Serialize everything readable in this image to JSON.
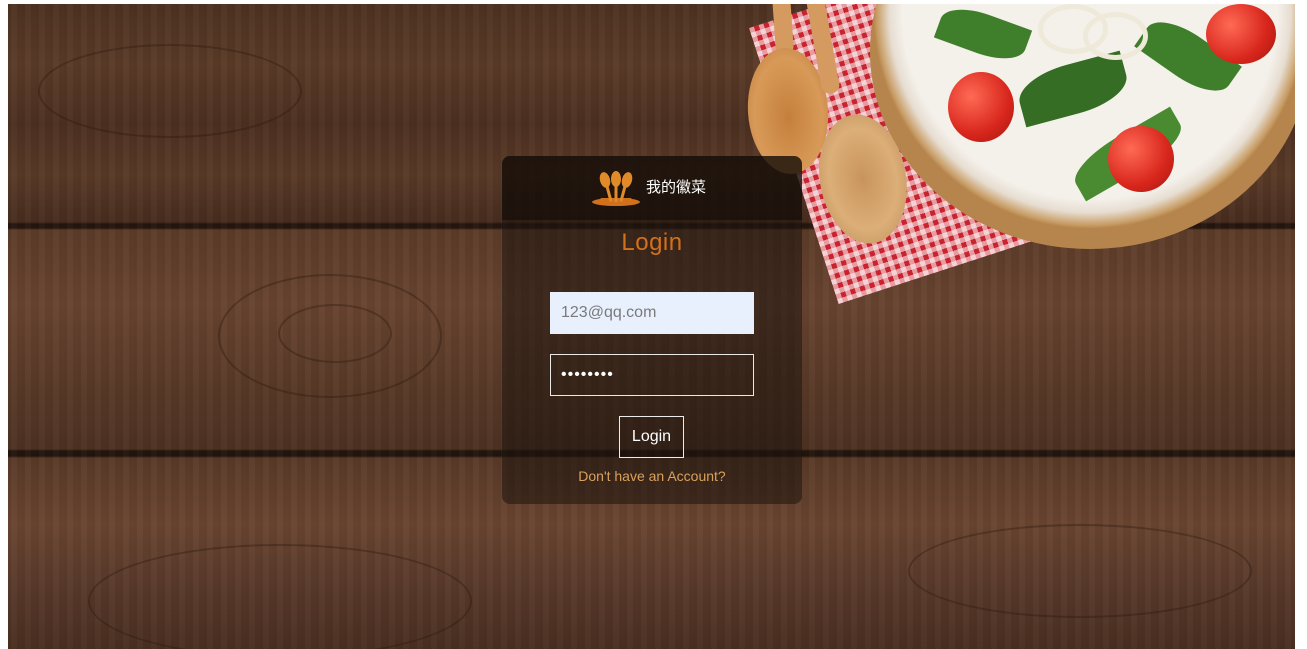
{
  "brand": {
    "name": "我的徽菜",
    "logo_icon": "spoons-logo-icon"
  },
  "login": {
    "title": "Login",
    "email_value": "123@qq.com",
    "password_value": "••••••••",
    "submit_label": "Login",
    "signup_link": "Don't have an Account?"
  },
  "colors": {
    "accent": "#d2711c",
    "link": "#d9a15c",
    "autofill_bg": "#e8f0fe"
  }
}
